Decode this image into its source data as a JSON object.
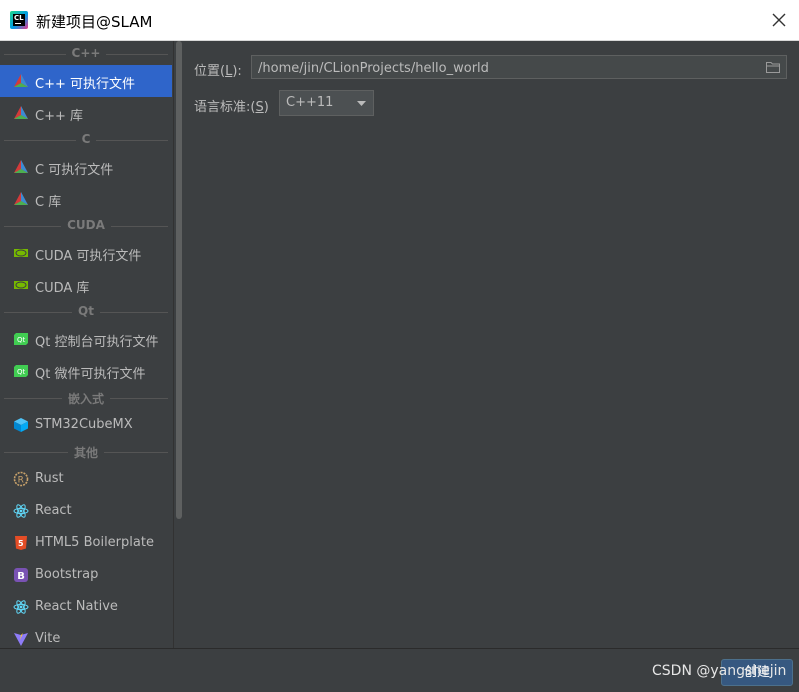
{
  "window": {
    "title": "新建项目@SLAM",
    "app_icon": "clion-icon"
  },
  "sidebar": {
    "groups": [
      {
        "header": "C++",
        "items": [
          {
            "label": "C++ 可执行文件",
            "icon": "cmake-triangle-icon",
            "selected": true
          },
          {
            "label": "C++ 库",
            "icon": "cmake-triangle-icon"
          }
        ]
      },
      {
        "header": "C",
        "items": [
          {
            "label": "C 可执行文件",
            "icon": "cmake-triangle-icon"
          },
          {
            "label": "C 库",
            "icon": "cmake-triangle-icon"
          }
        ]
      },
      {
        "header": "CUDA",
        "items": [
          {
            "label": "CUDA 可执行文件",
            "icon": "nvidia-icon"
          },
          {
            "label": "CUDA 库",
            "icon": "nvidia-icon"
          }
        ]
      },
      {
        "header": "Qt",
        "items": [
          {
            "label": "Qt 控制台可执行文件",
            "icon": "qt-icon"
          },
          {
            "label": "Qt 微件可执行文件",
            "icon": "qt-icon"
          }
        ]
      },
      {
        "header": "嵌入式",
        "items": [
          {
            "label": "STM32CubeMX",
            "icon": "cube-icon"
          }
        ]
      },
      {
        "header": "其他",
        "items": [
          {
            "label": "Rust",
            "icon": "rust-icon"
          },
          {
            "label": "React",
            "icon": "react-icon"
          },
          {
            "label": "HTML5 Boilerplate",
            "icon": "html5-icon"
          },
          {
            "label": "Bootstrap",
            "icon": "bootstrap-icon"
          },
          {
            "label": "React Native",
            "icon": "react-icon"
          },
          {
            "label": "Vite",
            "icon": "vite-icon"
          }
        ]
      }
    ]
  },
  "form": {
    "location_label": "位置(",
    "location_mnemonic": "L",
    "location_label_end": "):",
    "location_value": "/home/jin/CLionProjects/hello_world",
    "standard_label": "语言标准:(",
    "standard_mnemonic": "S",
    "standard_label_end": ")",
    "standard_value": "C++11"
  },
  "footer": {
    "create_label": "创建",
    "watermark": "CSDN @yangshejin"
  },
  "colors": {
    "accent": "#2f65ca",
    "background": "#3c3f41",
    "button": "#365880"
  }
}
